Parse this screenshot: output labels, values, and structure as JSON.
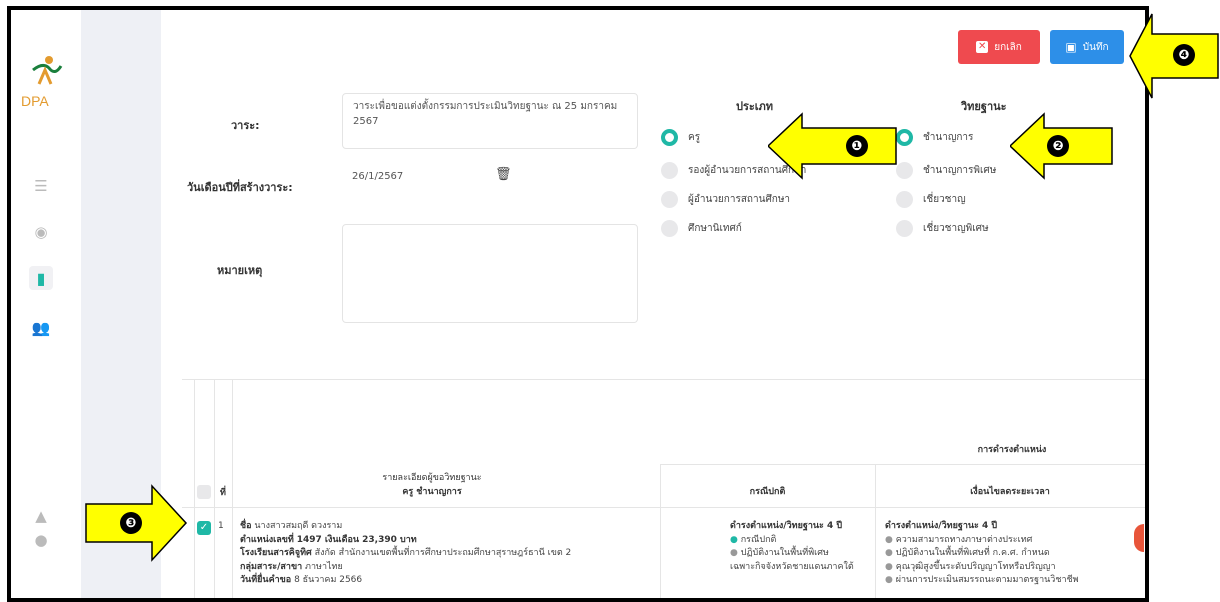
{
  "toolbar": {
    "cancel_label": "ยกเลิก",
    "save_label": "บันทึก"
  },
  "form": {
    "topic_label": "วาระ:",
    "topic_value": "วาระเพื่อขอแต่งตั้งกรรมการประเมินวิทยฐานะ ณ 25 มกราคม 2567",
    "date_label": "วันเดือนปีที่สร้างวาระ:",
    "date_value": "26/1/2567",
    "note_label": "หมายเหตุ"
  },
  "type": {
    "heading": "ประเภท",
    "options": [
      "ครู",
      "รองผู้อำนวยการสถานศึกษา",
      "ผู้อำนวยการสถานศึกษา",
      "ศึกษานิเทศก์"
    ],
    "selected": 0
  },
  "grade": {
    "heading": "วิทยฐานะ",
    "options": [
      "ชำนาญการ",
      "ชำนาญการพิเศษ",
      "เชี่ยวชาญ",
      "เชี่ยวชาญพิเศษ"
    ],
    "selected": 0
  },
  "table": {
    "col_no": "ที่",
    "col_detail_line1": "รายละเอียดผู้ขอวิทยฐานะ",
    "col_detail_line2": "ครู ชำนาญการ",
    "col_group": "การดำรงตำแหน่ง",
    "col_normal": "กรณีปกติ",
    "col_condition": "เงื่อนไขลดระยะเวลา",
    "row": {
      "no": "1",
      "name_label": "ชื่อ",
      "name_value": "นางสาวสมฤดี ดวงราม",
      "position_label": "ตำแหน่งเลขที่",
      "position_value": "1497 เงินเดือน 23,390 บาท",
      "school_label": "โรงเรียนสารคิจูทิศ",
      "school_value": "สังกัด สำนักงานเขตพื้นที่การศึกษาประถมศึกษาสุราษฎร์ธานี เขต 2",
      "subject_label": "กลุ่มสาระ/สาขา",
      "subject_value": "ภาษาไทย",
      "date_label": "วันที่ยื่นคำขอ",
      "date_value": "8 ธันวาคม 2566",
      "normal_title": "ดำรงตำแหน่ง/วิทยฐานะ 4 ปี",
      "normal_items": [
        "กรณีปกติ",
        "ปฏิบัติงานในพื้นที่พิเศษ",
        "เฉพาะกิจจังหวัดชายแดนภาคใต้"
      ],
      "cond_title": "ดำรงตำแหน่ง/วิทยฐานะ 4 ปี",
      "cond_items": [
        "ความสามารถทางภาษาต่างประเทศ",
        "ปฏิบัติงานในพื้นที่พิเศษที่ ก.ค.ศ. กำหนด",
        "คุณวุฒิสูงขึ้นระดับปริญญาโทหรือปริญญา",
        "ผ่านการประเมินสมรรถนะตามมาตรฐานวิชาชีพ"
      ]
    }
  },
  "callouts": [
    "❶",
    "❷",
    "❸",
    "❹"
  ],
  "colors": {
    "accent": "#1fb8a6",
    "cancel": "#ef4a4f",
    "save": "#2d8fe8",
    "callout": "#ffff00"
  }
}
